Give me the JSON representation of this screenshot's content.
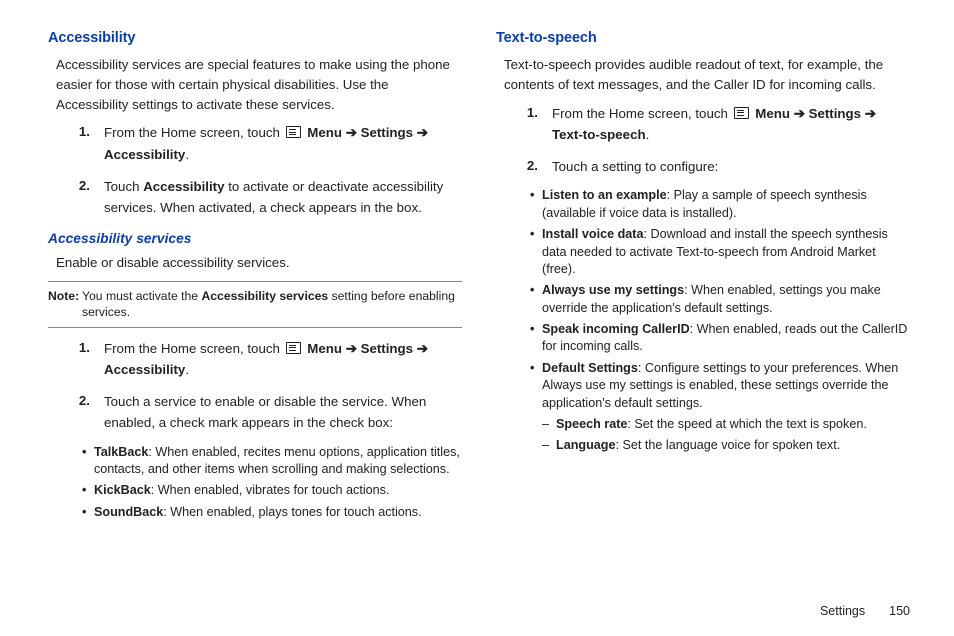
{
  "left": {
    "h_accessibility": "Accessibility",
    "intro": "Accessibility services are special features to make using the phone easier for those with certain physical disabilities. Use the Accessibility settings to activate these services.",
    "step1_pre": "From the Home screen, touch ",
    "menu": "Menu",
    "arrow": "➔",
    "settings": "Settings",
    "step1_post": "Accessibility",
    "step2a": "Touch ",
    "step2b": "Accessibility",
    "step2c": " to activate or deactivate accessibility services. When activated, a check appears in the box.",
    "h_services": "Accessibility services",
    "services_intro": "Enable or disable accessibility services.",
    "note_label": "Note:",
    "note_a": " You must activate the ",
    "note_b": "Accessibility services",
    "note_c": " setting before enabling services.",
    "svc_step2": "Touch a service to enable or disable the service. When enabled, a check mark appears in the check box:",
    "b_talkback": "TalkBack",
    "b_talkback_d": ": When enabled, recites menu options, application titles, contacts, and other items when scrolling and making selections.",
    "b_kickback": "KickBack",
    "b_kickback_d": ": When enabled, vibrates for touch actions.",
    "b_soundback": "SoundBack",
    "b_soundback_d": ": When enabled, plays tones for touch actions."
  },
  "right": {
    "h_tts": "Text-to-speech",
    "intro": "Text-to-speech provides audible readout of text, for example, the contents of text messages, and the Caller ID for incoming calls.",
    "step1_post": "Text-to-speech",
    "step2": "Touch a setting to configure:",
    "b_listen": "Listen to an example",
    "b_listen_d": ": Play a sample of speech synthesis (available if voice data is installed).",
    "b_install": "Install voice data",
    "b_install_d": ": Download and install the speech synthesis data needed to activate Text-to-speech from Android Market (free).",
    "b_always": "Always use my settings",
    "b_always_d": ": When enabled, settings you make override the application's default settings.",
    "b_speak": "Speak incoming CallerID",
    "b_speak_d": ": When enabled, reads out the CallerID for incoming calls.",
    "b_default": "Default Settings",
    "b_default_d": ": Configure settings to your preferences. When Always use my settings is enabled, these settings override the application's default settings.",
    "d_rate": "Speech rate",
    "d_rate_d": ": Set the speed at which the text is spoken.",
    "d_lang": "Language",
    "d_lang_d": ": Set the language voice for spoken text."
  },
  "footer": {
    "label": "Settings",
    "page": "150"
  },
  "nums": {
    "n1": "1.",
    "n2": "2."
  },
  "period": "."
}
